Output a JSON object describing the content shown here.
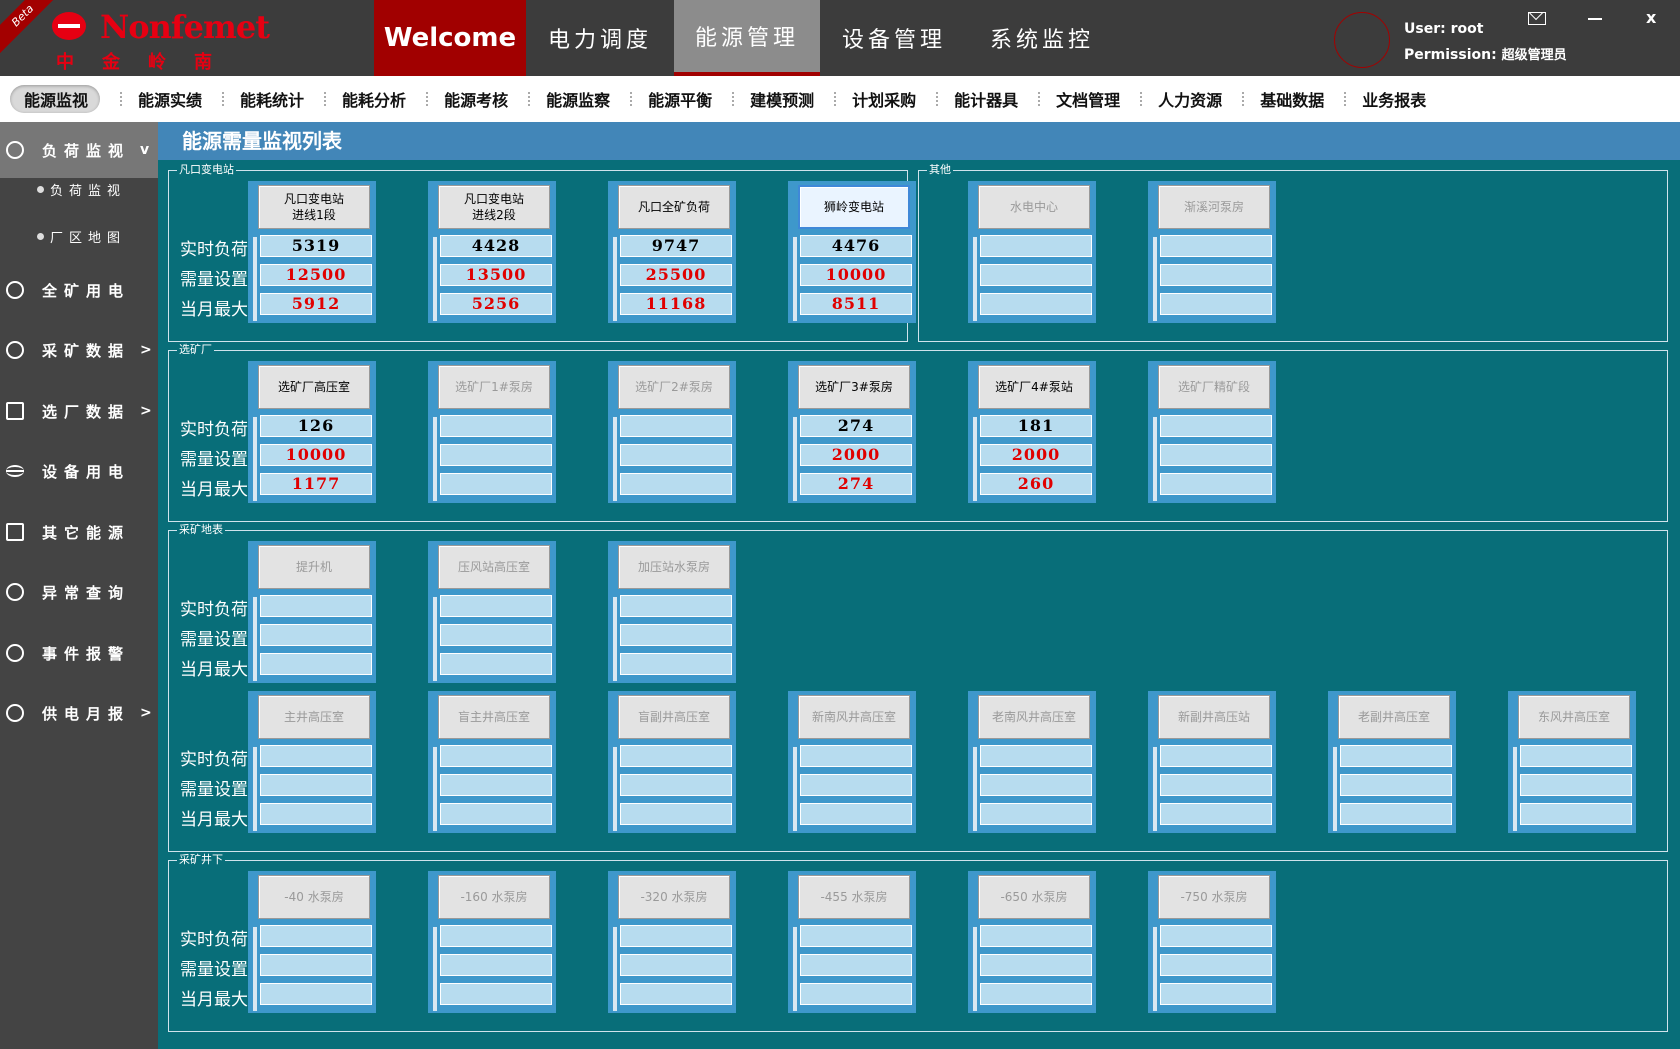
{
  "header": {
    "beta": "Beta",
    "logo_en": "Nonfemet",
    "logo_cn": "中金岭南",
    "tabs": [
      {
        "label": "Welcome"
      },
      {
        "label": "电力调度"
      },
      {
        "label": "能源管理"
      },
      {
        "label": "设备管理"
      },
      {
        "label": "系统监控"
      }
    ],
    "user_label": "User:",
    "user_value": "root",
    "perm_label": "Permission:",
    "perm_value": "超级管理员",
    "close": "x"
  },
  "subnav": [
    {
      "label": "能源监视"
    },
    {
      "label": "能源实绩"
    },
    {
      "label": "能耗统计"
    },
    {
      "label": "能耗分析"
    },
    {
      "label": "能源考核"
    },
    {
      "label": "能源监察"
    },
    {
      "label": "能源平衡"
    },
    {
      "label": "建模预测"
    },
    {
      "label": "计划采购"
    },
    {
      "label": "能计器具"
    },
    {
      "label": "文档管理"
    },
    {
      "label": "人力资源"
    },
    {
      "label": "基础数据"
    },
    {
      "label": "业务报表"
    }
  ],
  "sidebar": {
    "items": [
      {
        "label": "负荷监视",
        "arrow": "v",
        "icon": "globe-icon"
      },
      {
        "label": "全矿用电",
        "arrow": "",
        "icon": "refresh-icon"
      },
      {
        "label": "采矿数据",
        "arrow": ">",
        "icon": "location-pin-icon"
      },
      {
        "label": "选厂数据",
        "arrow": ">",
        "icon": "edit-icon"
      },
      {
        "label": "设备用电",
        "arrow": "",
        "icon": "list-icon"
      },
      {
        "label": "其它能源",
        "arrow": "",
        "icon": "shield-icon"
      },
      {
        "label": "异常查询",
        "arrow": "",
        "icon": "globe-icon"
      },
      {
        "label": "事件报警",
        "arrow": "",
        "icon": "refresh-icon"
      },
      {
        "label": "供电月报",
        "arrow": ">",
        "icon": "location-pin-icon"
      }
    ],
    "subitems": [
      {
        "label": "负荷监视"
      },
      {
        "label": "厂区地图"
      }
    ]
  },
  "content": {
    "title": "能源需量监视列表",
    "row_labels": [
      "实时负荷",
      "需量设置",
      "当月最大"
    ],
    "groups": [
      {
        "title": "凡口变电站",
        "cards": [
          {
            "name": "凡口变电站\n进线1段",
            "load": "5319",
            "demand": "12500",
            "max": "5912"
          },
          {
            "name": "凡口变电站\n进线2段",
            "load": "4428",
            "demand": "13500",
            "max": "5256"
          },
          {
            "name": "凡口全矿负荷",
            "load": "9747",
            "demand": "25500",
            "max": "11168"
          }
        ]
      },
      {
        "title": "其他",
        "cards": [
          {
            "name": "狮岭变电站",
            "load": "4476",
            "demand": "10000",
            "max": "8511"
          },
          {
            "name": "水电中心",
            "load": "",
            "demand": "",
            "max": ""
          },
          {
            "name": "渐溪河泵房",
            "load": "",
            "demand": "",
            "max": ""
          }
        ]
      },
      {
        "title": "选矿厂",
        "cards": [
          {
            "name": "选矿厂高压室",
            "load": "126",
            "demand": "10000",
            "max": "1177"
          },
          {
            "name": "选矿厂1#泵房",
            "load": "",
            "demand": "",
            "max": ""
          },
          {
            "name": "选矿厂2#泵房",
            "load": "",
            "demand": "",
            "max": ""
          },
          {
            "name": "选矿厂3#泵房",
            "load": "274",
            "demand": "2000",
            "max": "274"
          },
          {
            "name": "选矿厂4#泵站",
            "load": "181",
            "demand": "2000",
            "max": "260"
          },
          {
            "name": "选矿厂精矿段",
            "load": "",
            "demand": "",
            "max": ""
          }
        ]
      },
      {
        "title": "采矿地表",
        "cards": [
          {
            "name": "提升机",
            "load": "",
            "demand": "",
            "max": ""
          },
          {
            "name": "压风站高压室",
            "load": "",
            "demand": "",
            "max": ""
          },
          {
            "name": "加压站水泵房",
            "load": "",
            "demand": "",
            "max": ""
          },
          {
            "name": "主井高压室",
            "load": "",
            "demand": "",
            "max": ""
          },
          {
            "name": "盲主井高压室",
            "load": "",
            "demand": "",
            "max": ""
          },
          {
            "name": "盲副井高压室",
            "load": "",
            "demand": "",
            "max": ""
          },
          {
            "name": "新南风井高压室",
            "load": "",
            "demand": "",
            "max": ""
          },
          {
            "name": "老南风井高压室",
            "load": "",
            "demand": "",
            "max": ""
          },
          {
            "name": "新副井高压站",
            "load": "",
            "demand": "",
            "max": ""
          },
          {
            "name": "老副井高压室",
            "load": "",
            "demand": "",
            "max": ""
          },
          {
            "name": "东风井高压室",
            "load": "",
            "demand": "",
            "max": ""
          }
        ]
      },
      {
        "title": "采矿井下",
        "cards": [
          {
            "name": "-40 水泵房",
            "load": "",
            "demand": "",
            "max": ""
          },
          {
            "name": "-160 水泵房",
            "load": "",
            "demand": "",
            "max": ""
          },
          {
            "name": "-320 水泵房",
            "load": "",
            "demand": "",
            "max": ""
          },
          {
            "name": "-455 水泵房",
            "load": "",
            "demand": "",
            "max": ""
          },
          {
            "name": "-650 水泵房",
            "load": "",
            "demand": "",
            "max": ""
          },
          {
            "name": "-750 水泵房",
            "load": "",
            "demand": "",
            "max": ""
          }
        ]
      }
    ]
  },
  "colors": {
    "content_bg": "#086e79",
    "header_bg": "#3c3c3c",
    "accent_red": "#a10000",
    "title_bar": "#4286b8",
    "value_red": "#e00000"
  }
}
